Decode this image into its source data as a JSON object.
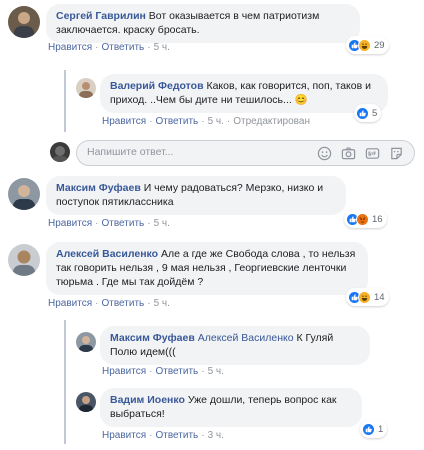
{
  "comments": [
    {
      "author": "Сергей Гаврилин",
      "text": "Вот оказывается в чем патриотизм заключается. краску бросать.",
      "like_label": "Нравится",
      "reply_label": "Ответить",
      "time": "5 ч.",
      "reaction_count": "29"
    },
    {
      "author": "Валерий Федотов",
      "text": "Каков, как говорится, поп, таков и приход. ..Чем бы дите ни тешилось...",
      "emoji": "😊",
      "like_label": "Нравится",
      "reply_label": "Ответить",
      "time": "5 ч.",
      "edited_label": "Отредактирован",
      "reaction_count": "5"
    },
    {
      "author": "Максим Фуфаев",
      "text": "И чему радоваться? Мерзко, низко и поступок пятиклассника",
      "like_label": "Нравится",
      "reply_label": "Ответить",
      "time": "5 ч.",
      "reaction_count": "16"
    },
    {
      "author": "Алексей Василенко",
      "text": "Але а где же Свобода слова , то нельзя так говорить нельзя , 9 мая нельзя , Георгиевские ленточки тюрьма . Где мы так дойдём ?",
      "like_label": "Нравится",
      "reply_label": "Ответить",
      "time": "5 ч.",
      "reaction_count": "14"
    },
    {
      "author": "Максим Фуфаев",
      "mention": "Алексей Василенко",
      "text": "К Гуляй Полю идем(((",
      "like_label": "Нравится",
      "reply_label": "Ответить",
      "time": "5 ч."
    },
    {
      "author": "Вадим Иоенко",
      "text": "Уже дошли, теперь вопрос как выбраться!",
      "like_label": "Нравится",
      "reply_label": "Ответить",
      "time": "3 ч.",
      "reaction_count": "1"
    }
  ],
  "reply_box": {
    "placeholder": "Напишите ответ..."
  },
  "colors": {
    "link": "#385898",
    "like_blue": "#1877f2",
    "haha_yellow": "#f7b125",
    "love_red": "#f33e58"
  }
}
